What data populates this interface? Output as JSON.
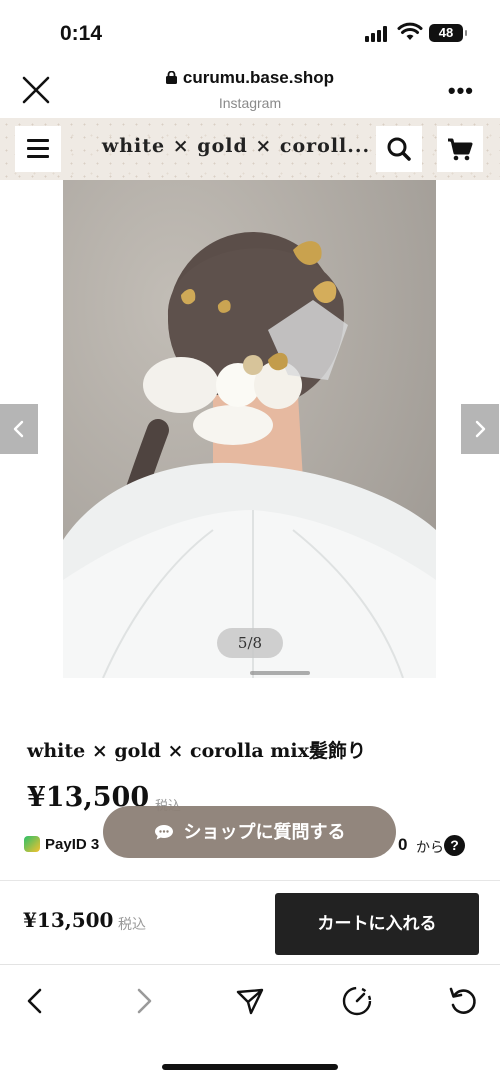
{
  "status_bar": {
    "time": "0:14",
    "battery": "48"
  },
  "browser": {
    "url": "curumu.base.shop",
    "source": "Instagram"
  },
  "shop": {
    "title": "white × gold × coroll..."
  },
  "gallery": {
    "counter": "5/8"
  },
  "product": {
    "name": "white × gold × corolla mix髪飾り",
    "price": "¥13,500",
    "tax_label": "税込",
    "payid_label": "PayID 3",
    "payid_amount": "0",
    "payid_suffix": "から",
    "help": "?"
  },
  "ask_button": {
    "label": "ショップに質問する"
  },
  "purchase_bar": {
    "price": "¥13,500",
    "tax_label": "税込",
    "add_to_cart": "カートに入れる"
  },
  "colors": {
    "accent_dark": "#222222",
    "header_bg": "#efeae4",
    "ask_button_bg": "#8c8076"
  }
}
